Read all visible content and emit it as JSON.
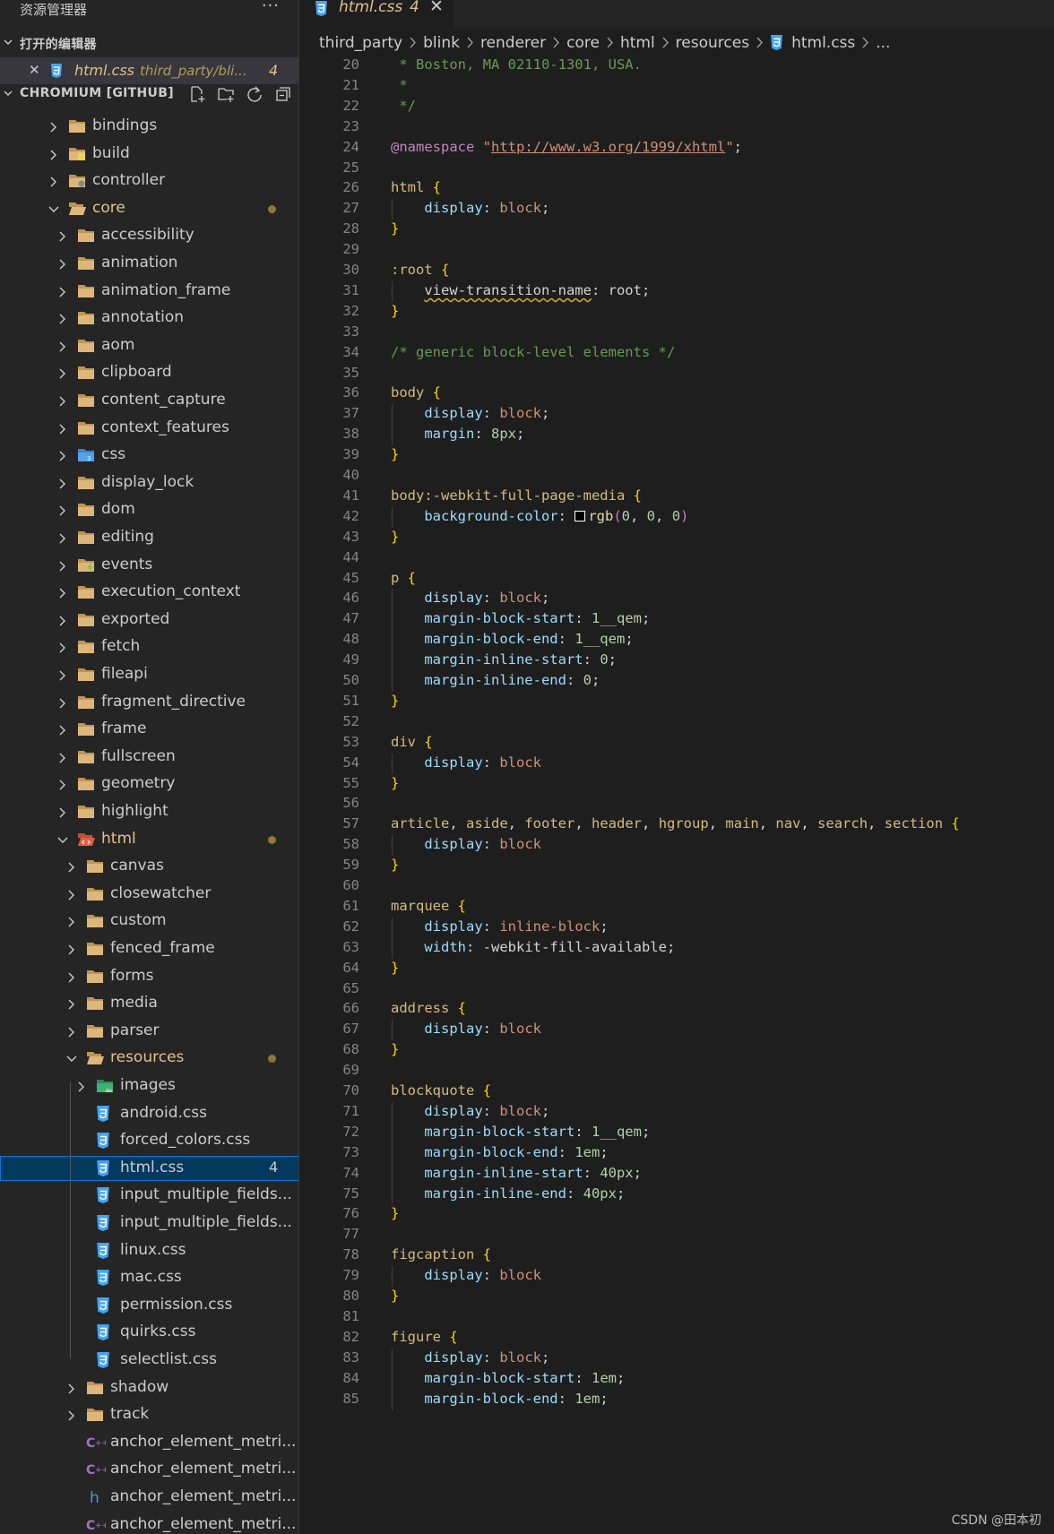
{
  "sidebar": {
    "title": "资源管理器",
    "more": "···",
    "open_editors_label": "打开的编辑器",
    "open_editor": {
      "name": "html.css",
      "path": "third_party/bli...",
      "count": "4"
    },
    "project_label": "CHROMIUM [GITHUB]",
    "tree": [
      {
        "label": "bindings",
        "icon": "folder-icon"
      },
      {
        "label": "build",
        "icon": "folder-build-icon"
      },
      {
        "label": "controller",
        "icon": "folder-controller-icon"
      },
      {
        "label": "core",
        "icon": "folder-open-icon"
      },
      {
        "label": "accessibility",
        "icon": "folder-icon"
      },
      {
        "label": "animation",
        "icon": "folder-icon"
      },
      {
        "label": "animation_frame",
        "icon": "folder-icon"
      },
      {
        "label": "annotation",
        "icon": "folder-icon"
      },
      {
        "label": "aom",
        "icon": "folder-icon"
      },
      {
        "label": "clipboard",
        "icon": "folder-icon"
      },
      {
        "label": "content_capture",
        "icon": "folder-icon"
      },
      {
        "label": "context_features",
        "icon": "folder-icon"
      },
      {
        "label": "css",
        "icon": "folder-css-icon"
      },
      {
        "label": "display_lock",
        "icon": "folder-icon"
      },
      {
        "label": "dom",
        "icon": "folder-icon"
      },
      {
        "label": "editing",
        "icon": "folder-icon"
      },
      {
        "label": "events",
        "icon": "folder-events-icon"
      },
      {
        "label": "execution_context",
        "icon": "folder-icon"
      },
      {
        "label": "exported",
        "icon": "folder-icon"
      },
      {
        "label": "fetch",
        "icon": "folder-icon"
      },
      {
        "label": "fileapi",
        "icon": "folder-icon"
      },
      {
        "label": "fragment_directive",
        "icon": "folder-icon"
      },
      {
        "label": "frame",
        "icon": "folder-icon"
      },
      {
        "label": "fullscreen",
        "icon": "folder-icon"
      },
      {
        "label": "geometry",
        "icon": "folder-icon"
      },
      {
        "label": "highlight",
        "icon": "folder-icon"
      },
      {
        "label": "html",
        "icon": "folder-html-icon"
      },
      {
        "label": "canvas",
        "icon": "folder-icon"
      },
      {
        "label": "closewatcher",
        "icon": "folder-icon"
      },
      {
        "label": "custom",
        "icon": "folder-icon"
      },
      {
        "label": "fenced_frame",
        "icon": "folder-icon"
      },
      {
        "label": "forms",
        "icon": "folder-icon"
      },
      {
        "label": "media",
        "icon": "folder-icon"
      },
      {
        "label": "parser",
        "icon": "folder-icon"
      },
      {
        "label": "resources",
        "icon": "folder-open-icon"
      },
      {
        "label": "images",
        "icon": "folder-images-icon"
      },
      {
        "label": "android.css",
        "icon": "css-file-icon"
      },
      {
        "label": "forced_colors.css",
        "icon": "css-file-icon"
      },
      {
        "label": "html.css",
        "icon": "css-file-icon",
        "badge": "4"
      },
      {
        "label": "input_multiple_fields...",
        "icon": "css-file-icon"
      },
      {
        "label": "input_multiple_fields...",
        "icon": "css-file-icon"
      },
      {
        "label": "linux.css",
        "icon": "css-file-icon"
      },
      {
        "label": "mac.css",
        "icon": "css-file-icon"
      },
      {
        "label": "permission.css",
        "icon": "css-file-icon"
      },
      {
        "label": "quirks.css",
        "icon": "css-file-icon"
      },
      {
        "label": "selectlist.css",
        "icon": "css-file-icon"
      },
      {
        "label": "shadow",
        "icon": "folder-icon"
      },
      {
        "label": "track",
        "icon": "folder-icon"
      },
      {
        "label": "anchor_element_metri...",
        "icon": "cpp-file-icon"
      },
      {
        "label": "anchor_element_metri...",
        "icon": "cpp-file-icon"
      },
      {
        "label": "anchor_element_metri...",
        "icon": "h-file-icon"
      },
      {
        "label": "anchor_element_metri...",
        "icon": "cpp-file-icon"
      }
    ]
  },
  "editor": {
    "tab": {
      "name": "html.css",
      "count": "4"
    },
    "breadcrumb": [
      "third_party",
      "blink",
      "renderer",
      "core",
      "html",
      "resources",
      "html.css",
      "..."
    ],
    "lines": [
      {
        "n": "20",
        "t": " * Boston, MA 02110-1301, USA."
      },
      {
        "n": "21",
        "t": " *"
      },
      {
        "n": "22",
        "t": " */"
      },
      {
        "n": "23",
        "t": ""
      },
      {
        "n": "24",
        "t": "@namespace \"http://www.w3.org/1999/xhtml\";"
      },
      {
        "n": "25",
        "t": ""
      },
      {
        "n": "26",
        "t": "html {"
      },
      {
        "n": "27",
        "t": "    display: block;"
      },
      {
        "n": "28",
        "t": "}"
      },
      {
        "n": "29",
        "t": ""
      },
      {
        "n": "30",
        "t": ":root {"
      },
      {
        "n": "31",
        "t": "    view-transition-name: root;"
      },
      {
        "n": "32",
        "t": "}"
      },
      {
        "n": "33",
        "t": ""
      },
      {
        "n": "34",
        "t": "/* generic block-level elements */"
      },
      {
        "n": "35",
        "t": ""
      },
      {
        "n": "36",
        "t": "body {"
      },
      {
        "n": "37",
        "t": "    display: block;"
      },
      {
        "n": "38",
        "t": "    margin: 8px;"
      },
      {
        "n": "39",
        "t": "}"
      },
      {
        "n": "40",
        "t": ""
      },
      {
        "n": "41",
        "t": "body:-webkit-full-page-media {"
      },
      {
        "n": "42",
        "t": "    background-color: rgb(0, 0, 0)"
      },
      {
        "n": "43",
        "t": "}"
      },
      {
        "n": "44",
        "t": ""
      },
      {
        "n": "45",
        "t": "p {"
      },
      {
        "n": "46",
        "t": "    display: block;"
      },
      {
        "n": "47",
        "t": "    margin-block-start: 1__qem;"
      },
      {
        "n": "48",
        "t": "    margin-block-end: 1__qem;"
      },
      {
        "n": "49",
        "t": "    margin-inline-start: 0;"
      },
      {
        "n": "50",
        "t": "    margin-inline-end: 0;"
      },
      {
        "n": "51",
        "t": "}"
      },
      {
        "n": "52",
        "t": ""
      },
      {
        "n": "53",
        "t": "div {"
      },
      {
        "n": "54",
        "t": "    display: block"
      },
      {
        "n": "55",
        "t": "}"
      },
      {
        "n": "56",
        "t": ""
      },
      {
        "n": "57",
        "t": "article, aside, footer, header, hgroup, main, nav, search, section {"
      },
      {
        "n": "58",
        "t": "    display: block"
      },
      {
        "n": "59",
        "t": "}"
      },
      {
        "n": "60",
        "t": ""
      },
      {
        "n": "61",
        "t": "marquee {"
      },
      {
        "n": "62",
        "t": "    display: inline-block;"
      },
      {
        "n": "63",
        "t": "    width: -webkit-fill-available;"
      },
      {
        "n": "64",
        "t": "}"
      },
      {
        "n": "65",
        "t": ""
      },
      {
        "n": "66",
        "t": "address {"
      },
      {
        "n": "67",
        "t": "    display: block"
      },
      {
        "n": "68",
        "t": "}"
      },
      {
        "n": "69",
        "t": ""
      },
      {
        "n": "70",
        "t": "blockquote {"
      },
      {
        "n": "71",
        "t": "    display: block;"
      },
      {
        "n": "72",
        "t": "    margin-block-start: 1__qem;"
      },
      {
        "n": "73",
        "t": "    margin-block-end: 1em;"
      },
      {
        "n": "74",
        "t": "    margin-inline-start: 40px;"
      },
      {
        "n": "75",
        "t": "    margin-inline-end: 40px;"
      },
      {
        "n": "76",
        "t": "}"
      },
      {
        "n": "77",
        "t": ""
      },
      {
        "n": "78",
        "t": "figcaption {"
      },
      {
        "n": "79",
        "t": "    display: block"
      },
      {
        "n": "80",
        "t": "}"
      },
      {
        "n": "81",
        "t": ""
      },
      {
        "n": "82",
        "t": "figure {"
      },
      {
        "n": "83",
        "t": "    display: block;"
      },
      {
        "n": "84",
        "t": "    margin-block-start: 1em;"
      },
      {
        "n": "85",
        "t": "    margin-block-end: 1em;"
      }
    ]
  },
  "watermark": "CSDN @田本初",
  "colors": {
    "accent": "#0078d4",
    "modified": "#e2c08d",
    "folder": "#c09553",
    "css": "#42a5f5"
  }
}
